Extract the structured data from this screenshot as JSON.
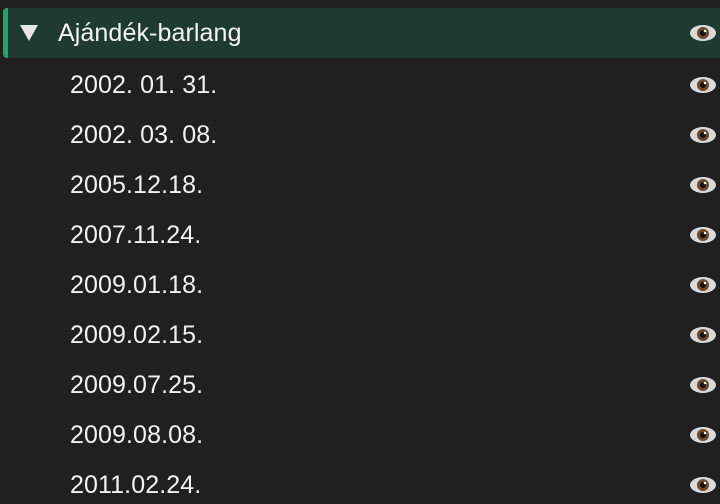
{
  "group": {
    "title": "Ajándék-barlang",
    "expanded": true,
    "disclosure_icon": "triangle-down-icon",
    "visibility_icon": "eye-icon"
  },
  "items": [
    {
      "label": "2002. 01. 31.",
      "visibility_icon": "eye-icon"
    },
    {
      "label": "2002. 03. 08.",
      "visibility_icon": "eye-icon"
    },
    {
      "label": "2005.12.18.",
      "visibility_icon": "eye-icon"
    },
    {
      "label": "2007.11.24.",
      "visibility_icon": "eye-icon"
    },
    {
      "label": "2009.01.18.",
      "visibility_icon": "eye-icon"
    },
    {
      "label": "2009.02.15.",
      "visibility_icon": "eye-icon"
    },
    {
      "label": "2009.07.25.",
      "visibility_icon": "eye-icon"
    },
    {
      "label": "2009.08.08.",
      "visibility_icon": "eye-icon"
    },
    {
      "label": "2011.02.24.",
      "visibility_icon": "eye-icon"
    }
  ],
  "colors": {
    "background": "#202020",
    "header_background": "#1e3a31",
    "header_accent": "#2e9e6e",
    "text": "#f1f1f1"
  }
}
